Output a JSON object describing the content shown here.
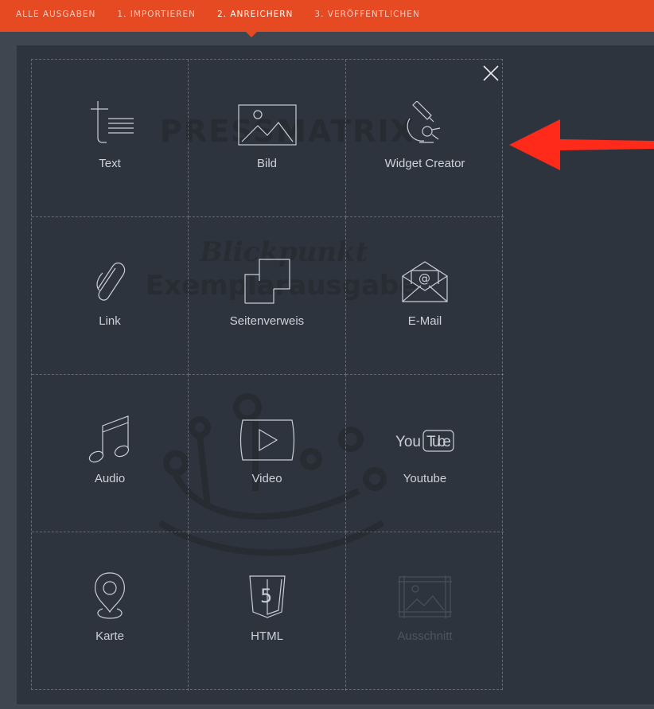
{
  "nav": {
    "items": [
      {
        "label": "ALLE AUSGABEN"
      },
      {
        "label": "1. IMPORTIEREN"
      },
      {
        "label": "2. ANREICHERN"
      },
      {
        "label": "3. VERÖFFENTLICHEN"
      }
    ],
    "active_index": 2,
    "bar_color": "#e54a22"
  },
  "background_page": {
    "brand": "PRESSMATRIX",
    "line1": "Blickpunkt",
    "line2": "Exemplarausgabe"
  },
  "panel": {
    "close_icon": "close-icon",
    "tiles": [
      {
        "label": "Text",
        "icon": "text-icon",
        "enabled": true
      },
      {
        "label": "Bild",
        "icon": "image-icon",
        "enabled": true
      },
      {
        "label": "Widget Creator",
        "icon": "microscope-icon",
        "enabled": true
      },
      {
        "label": "Link",
        "icon": "paperclip-icon",
        "enabled": true
      },
      {
        "label": "Seitenverweis",
        "icon": "page-reference-icon",
        "enabled": true
      },
      {
        "label": "E-Mail",
        "icon": "email-icon",
        "enabled": true
      },
      {
        "label": "Audio",
        "icon": "music-note-icon",
        "enabled": true
      },
      {
        "label": "Video",
        "icon": "video-play-icon",
        "enabled": true
      },
      {
        "label": "Youtube",
        "icon": "youtube-icon",
        "enabled": true
      },
      {
        "label": "Karte",
        "icon": "map-pin-icon",
        "enabled": true
      },
      {
        "label": "HTML",
        "icon": "html5-icon",
        "enabled": true
      },
      {
        "label": "Ausschnitt",
        "icon": "crop-icon",
        "enabled": false
      }
    ],
    "youtube_logo": {
      "you": "You",
      "tube": "Tube"
    },
    "html_logo": "5"
  },
  "annotation": {
    "arrow_color": "#ff2a1a"
  }
}
